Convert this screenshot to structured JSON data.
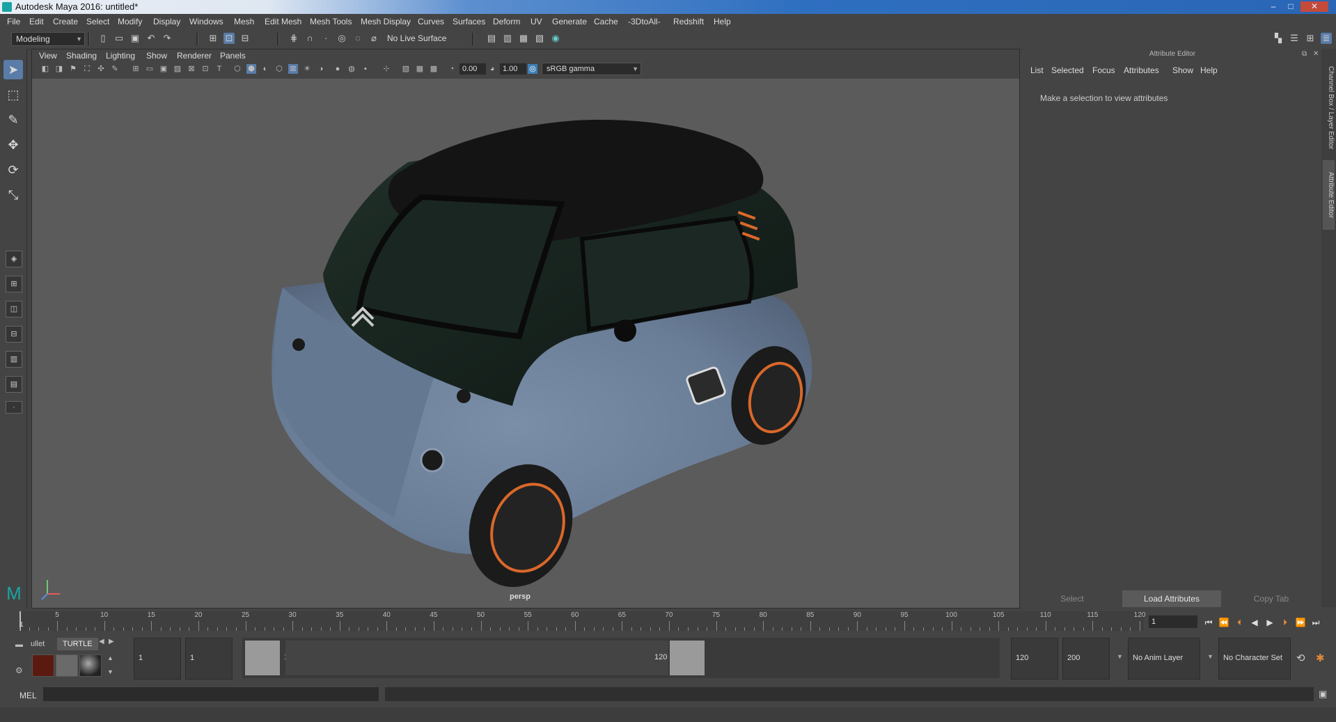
{
  "window": {
    "title": "Autodesk Maya 2016: untitled*",
    "minimize": "–",
    "maximize": "□",
    "close": "✕"
  },
  "menu": [
    "File",
    "Edit",
    "Create",
    "Select",
    "Modify",
    "Display",
    "Windows",
    "Mesh",
    "Edit Mesh",
    "Mesh Tools",
    "Mesh Display",
    "Curves",
    "Surfaces",
    "Deform",
    "UV",
    "Generate",
    "Cache",
    "-3DtoAll-",
    "Redshift",
    "Help"
  ],
  "status": {
    "mode": "Modeling",
    "live_surface": "No Live Surface"
  },
  "viewport": {
    "menu": [
      "View",
      "Shading",
      "Lighting",
      "Show",
      "Renderer",
      "Panels"
    ],
    "exposure": "0.00",
    "gamma": "1.00",
    "color_space": "sRGB gamma",
    "camera": "persp"
  },
  "attribute_editor": {
    "title": "Attribute Editor",
    "menu": [
      "List",
      "Selected",
      "Focus",
      "Attributes",
      "Show",
      "Help"
    ],
    "message": "Make a selection to view attributes",
    "buttons": {
      "select": "Select",
      "load": "Load Attributes",
      "copy": "Copy Tab"
    },
    "side_tabs": [
      "Channel Box / Layer Editor",
      "Attribute Editor"
    ]
  },
  "timeslider": {
    "labels": [
      "5",
      "10",
      "15",
      "20",
      "25",
      "30",
      "35",
      "40",
      "45",
      "50",
      "55",
      "60",
      "65",
      "70",
      "75",
      "80",
      "85",
      "90",
      "95",
      "100",
      "105",
      "110",
      "115",
      "120"
    ],
    "current_frame": "1",
    "current_frame_field": "1"
  },
  "range": {
    "start": "1",
    "playback_start": "1",
    "range_start_label": "1",
    "range_end_label": "120",
    "playback_end": "120",
    "end": "200",
    "anim_layer": "No Anim Layer",
    "character_set": "No Character Set"
  },
  "shelf": {
    "tabs": [
      "ullet",
      "TURTLE"
    ]
  },
  "command": {
    "language": "MEL"
  }
}
